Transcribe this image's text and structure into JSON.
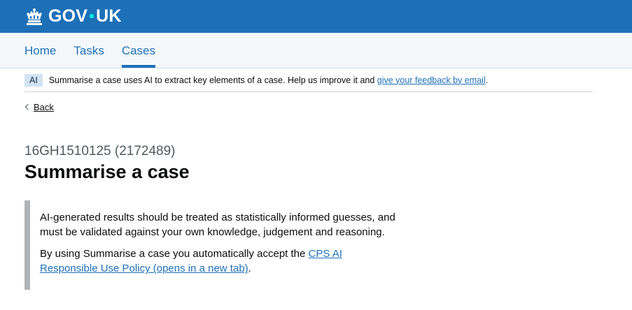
{
  "header": {
    "logo_text_1": "GOV",
    "logo_text_2": "UK",
    "crown_icon": "crown-icon"
  },
  "nav": {
    "items": [
      {
        "label": "Home",
        "active": false
      },
      {
        "label": "Tasks",
        "active": false
      },
      {
        "label": "Cases",
        "active": true
      }
    ]
  },
  "ai_banner": {
    "tag": "AI",
    "text": "Summarise a case uses AI to extract key elements of a case. Help us improve it and ",
    "link": "give your feedback by email",
    "suffix": "."
  },
  "back_link": "Back",
  "page": {
    "caption": "16GH1510125 (2172489)",
    "title": "Summarise a case"
  },
  "inset": {
    "para1": "AI-generated results should be treated as statistically informed guesses, and must be validated against your own knowledge, judgement and reasoning.",
    "para2_text": "By using Summarise a case you automatically accept the ",
    "para2_link": "CPS AI Responsible Use Policy (opens in a new tab)",
    "para2_suffix": "."
  },
  "colors": {
    "brand": "#1d70b8",
    "nav_bg": "#f4f8fb",
    "inset_border": "#b1b4b6"
  }
}
